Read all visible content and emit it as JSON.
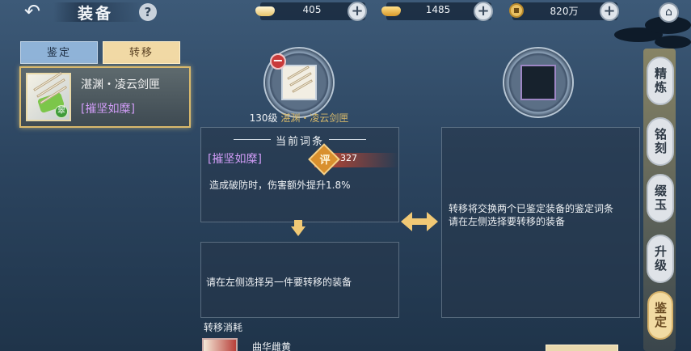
{
  "header": {
    "back_icon": "back-arrow-icon",
    "title": "装备",
    "help_label": "?",
    "currencies": [
      {
        "icon": "silver-ingot-icon",
        "value": "405"
      },
      {
        "icon": "gold-ingot-icon",
        "value": "1485"
      },
      {
        "icon": "copper-coin-icon",
        "value": "820万"
      }
    ],
    "plus_label": "+",
    "home_icon": "home-icon"
  },
  "left": {
    "tabs": [
      {
        "label": "鉴定",
        "active": false
      },
      {
        "label": "转移",
        "active": true
      }
    ],
    "equipment": {
      "name": "湛渊・凌云剑匣",
      "attribute": "[摧坚如糜]",
      "badge": "翠"
    }
  },
  "center": {
    "minus_label": "−",
    "slot_caption_level": "130级",
    "slot_caption_name": "湛渊・凌云剑匣",
    "current_entry": {
      "heading": "当前词条",
      "attr_name": "[摧坚如糜]",
      "score_label": "评",
      "score_value": "327",
      "description": "造成破防时，伤害额外提升1.8%"
    },
    "target_prompt": "请在左侧选择另一件要转移的装备",
    "info_text": "转移将交换两个已鉴定装备的鉴定词条\n请在左侧选择要转移的装备",
    "cost_label": "转移消耗",
    "cost_item_name": "曲华雌黄"
  },
  "side_tabs": [
    {
      "label": "精炼",
      "active": false
    },
    {
      "label": "铭刻",
      "active": false
    },
    {
      "label": "缀玉",
      "active": false
    },
    {
      "label": "升级",
      "active": false
    },
    {
      "label": "鉴定",
      "active": true
    }
  ],
  "colors": {
    "accent_gold": "#f1c975",
    "purple_attr": "#d09cf6",
    "score_red": "#c8462e"
  }
}
